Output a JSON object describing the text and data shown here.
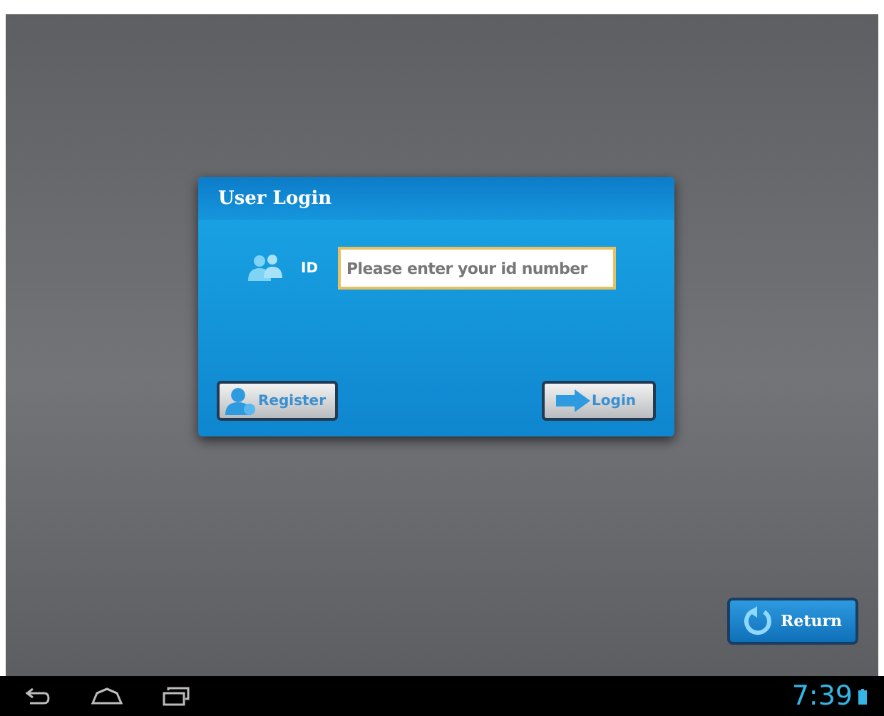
{
  "dialog": {
    "title": "User Login",
    "id_label": "ID",
    "id_field": {
      "placeholder": "Please enter your id number"
    },
    "buttons": [
      {
        "kind": "register",
        "label": "Register"
      },
      {
        "kind": "login",
        "label": "Login"
      }
    ]
  },
  "return_button": {
    "label": "Return"
  },
  "nav_bar": {
    "time": "7:39"
  }
}
